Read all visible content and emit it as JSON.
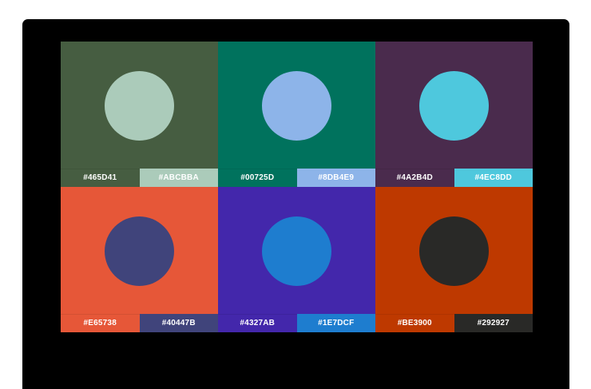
{
  "swatches": [
    {
      "background": "#465D41",
      "accent": "#ABCBBA",
      "background_label": "#465D41",
      "accent_label": "#ABCBBA"
    },
    {
      "background": "#00725D",
      "accent": "#8DB4E9",
      "background_label": "#00725D",
      "accent_label": "#8DB4E9"
    },
    {
      "background": "#4A2B4D",
      "accent": "#4EC8DD",
      "background_label": "#4A2B4D",
      "accent_label": "#4EC8DD"
    },
    {
      "background": "#E65738",
      "accent": "#40447B",
      "background_label": "#E65738",
      "accent_label": "#40447B"
    },
    {
      "background": "#4327AB",
      "accent": "#1E7DCF",
      "background_label": "#4327AB",
      "accent_label": "#1E7DCF"
    },
    {
      "background": "#BE3900",
      "accent": "#292927",
      "background_label": "#BE3900",
      "accent_label": "#292927"
    }
  ]
}
